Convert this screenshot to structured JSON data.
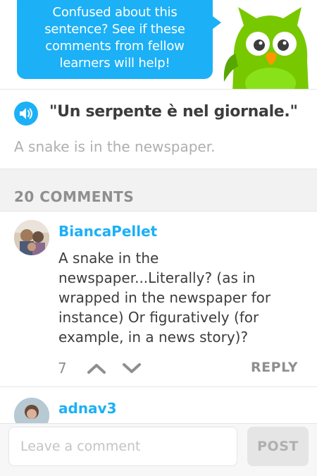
{
  "header": {
    "bubble_text": "Confused about this sentence? See if these comments from fellow learners will help!",
    "mascot_icon": "owl-mascot"
  },
  "sentence": {
    "speaker_icon": "speaker-icon",
    "text": "\"Un serpente è nel giornale.\"",
    "translation": "A snake is in the newspaper."
  },
  "comments_header": {
    "count_label": "20 COMMENTS"
  },
  "comments": [
    {
      "username": "BiancaPellet",
      "text": "A snake in the newspaper...Literally? (as in wrapped in the newspaper for instance) Or figuratively (for example, in a news story)?",
      "votes": "7",
      "reply_label": "REPLY"
    },
    {
      "username": "adnav3"
    }
  ],
  "footer": {
    "input_placeholder": "Leave a comment",
    "post_label": "POST"
  },
  "colors": {
    "brand_blue": "#1cb0f6",
    "owl_green": "#78c800",
    "owl_beak": "#ff9600"
  }
}
